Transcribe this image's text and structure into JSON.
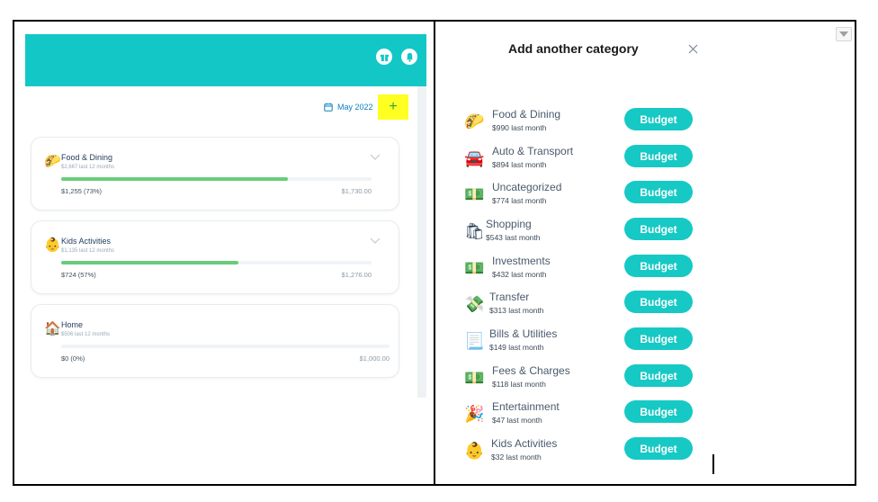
{
  "app": {
    "month_label": "May 2022",
    "add_label": "+"
  },
  "budgets": [
    {
      "name": "Food & Dining",
      "sub": "$2,667 last 12 months",
      "spent": "$1,255 (73%)",
      "limit": "$1,730.00",
      "progress": 0.73,
      "emoji": "🌮",
      "expandable": true
    },
    {
      "name": "Kids Activities",
      "sub": "$1,135 last 12 months",
      "spent": "$724 (57%)",
      "limit": "$1,276.00",
      "progress": 0.57,
      "emoji": "👶",
      "expandable": true
    },
    {
      "name": "Home",
      "sub": "$506 last 12 months",
      "spent": "$0 (0%)",
      "limit": "$1,000.00",
      "progress": 0.0,
      "emoji": "🏠",
      "expandable": false
    }
  ],
  "modal": {
    "title": "Add another category",
    "budget_label": "Budget",
    "categories": [
      {
        "name": "Food & Dining",
        "amount": "$990 last month",
        "emoji": "🌮"
      },
      {
        "name": "Auto & Transport",
        "amount": "$894 last month",
        "emoji": "🚘"
      },
      {
        "name": "Uncategorized",
        "amount": "$774 last month",
        "emoji": "💵"
      },
      {
        "name": "Shopping",
        "amount": "$543 last month",
        "emoji": "🛍"
      },
      {
        "name": "Investments",
        "amount": "$432 last month",
        "emoji": "💵"
      },
      {
        "name": "Transfer",
        "amount": "$313 last month",
        "emoji": "💸"
      },
      {
        "name": "Bills & Utilities",
        "amount": "$149 last month",
        "emoji": "📃"
      },
      {
        "name": "Fees & Charges",
        "amount": "$118 last month",
        "emoji": "💵"
      },
      {
        "name": "Entertainment",
        "amount": "$47 last month",
        "emoji": "🎉"
      },
      {
        "name": "Kids Activities",
        "amount": "$32 last month",
        "emoji": "👶"
      }
    ]
  },
  "colors": {
    "accent": "#14c7c7",
    "button": "#16c9c4",
    "progress": "#68cc7a",
    "highlight": "#ffff22"
  },
  "icons": {
    "gift": "gift-icon",
    "bell": "bell-icon",
    "calendar": "calendar-icon",
    "close": "close-icon",
    "chevron": "chevron-down-icon"
  }
}
